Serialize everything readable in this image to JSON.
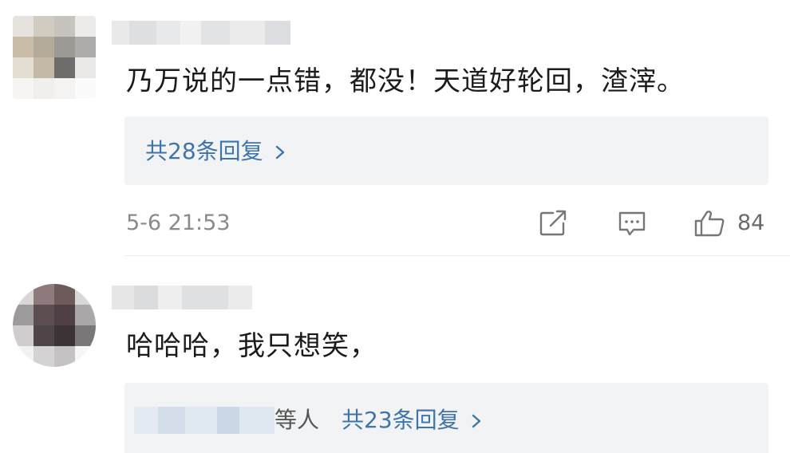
{
  "comments": [
    {
      "text": "乃万说的一点错，都没！天道好轮回，渣滓。",
      "reply_summary": "共28条回复",
      "timestamp": "5-6 21:53",
      "like_count": "84",
      "icons": [
        "share-icon",
        "comment-icon",
        "like-icon",
        "chevron-right-icon"
      ]
    },
    {
      "text": "哈哈哈，我只想笑，",
      "reply_prefix": "等人",
      "reply_summary": "共23条回复",
      "icons": [
        "chevron-right-icon"
      ]
    }
  ],
  "colors": {
    "link": "#3f73ab",
    "reply_box": "#f2f3f5",
    "meta_text": "#8a8a8a",
    "body_text": "#1b1b1b"
  }
}
